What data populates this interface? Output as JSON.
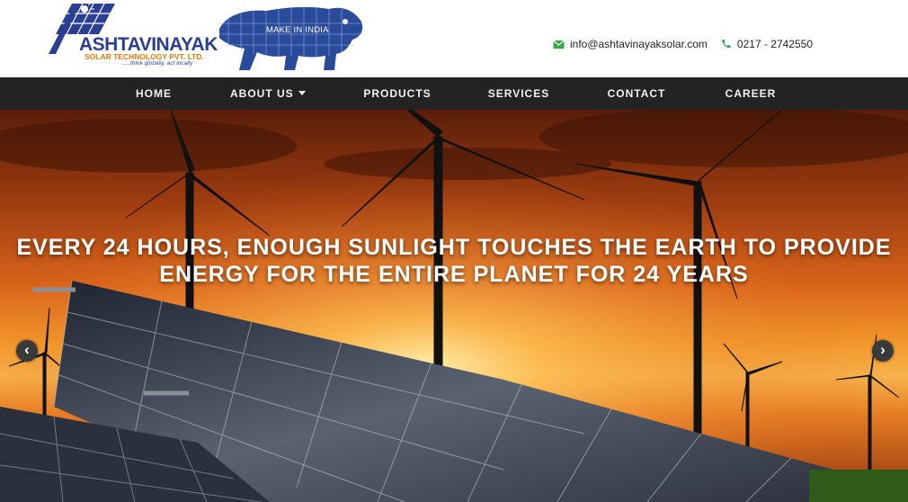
{
  "brand": {
    "name": "ASHTAVINAYAK",
    "subtitle": "SOLAR TECHNOLOGY PVT. LTD.",
    "tagline": ".....think globally, act locally",
    "colors": {
      "blue": "#2a3f91",
      "orange": "#e47a14"
    }
  },
  "make_in_india": {
    "label": "MAKE IN INDIA"
  },
  "contact": {
    "email": "info@ashtavinayaksolar.com",
    "phone": "0217 - 2742550",
    "email_icon": "envelope-icon",
    "phone_icon": "phone-icon",
    "icon_color": "#3aa64a"
  },
  "nav": {
    "background": "#232323",
    "items": [
      {
        "label": "HOME"
      },
      {
        "label": "ABOUT US",
        "dropdown": true
      },
      {
        "label": "PRODUCTS"
      },
      {
        "label": "SERVICES"
      },
      {
        "label": "CONTACT"
      },
      {
        "label": "CAREER"
      }
    ]
  },
  "hero": {
    "line1": "EVERY 24 HOURS, ENOUGH SUNLIGHT TOUCHES THE EARTH TO PROVIDE",
    "line2": "ENERGY FOR THE ENTIRE PLANET FOR 24 YEARS",
    "prev_icon": "chevron-left-icon",
    "next_icon": "chevron-right-icon",
    "prev_glyph": "‹",
    "next_glyph": "›"
  }
}
